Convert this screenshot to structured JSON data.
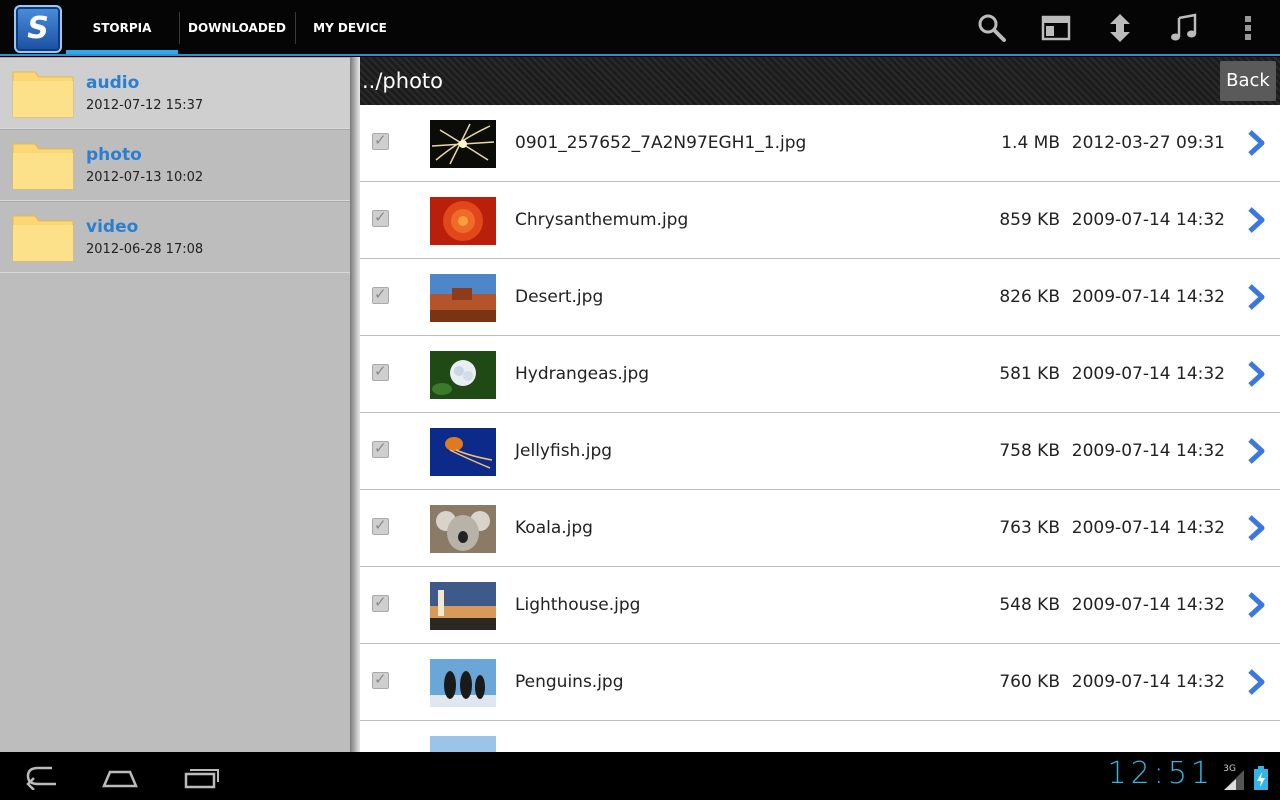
{
  "app": {
    "logo_letter": "S"
  },
  "tabs": [
    {
      "label": "STORPIA",
      "active": true
    },
    {
      "label": "DOWNLOADED",
      "active": false
    },
    {
      "label": "MY DEVICE",
      "active": false
    }
  ],
  "actionbar_icons": [
    "search-icon",
    "layout-icon",
    "sort-icon",
    "music-icon",
    "overflow-menu-icon"
  ],
  "sidebar": {
    "folders": [
      {
        "name": "audio",
        "date": "2012-07-12 15:37",
        "selected": true
      },
      {
        "name": "photo",
        "date": "2012-07-13 10:02",
        "selected": false
      },
      {
        "name": "video",
        "date": "2012-06-28 17:08",
        "selected": false
      }
    ]
  },
  "main": {
    "path": "../photo",
    "back_label": "Back",
    "files": [
      {
        "name": "0901_257652_7A2N97EGH1_1.jpg",
        "size": "1.4 MB",
        "date": "2012-03-27 09:31",
        "checked": true
      },
      {
        "name": "Chrysanthemum.jpg",
        "size": "859 KB",
        "date": "2009-07-14 14:32",
        "checked": true
      },
      {
        "name": "Desert.jpg",
        "size": "826 KB",
        "date": "2009-07-14 14:32",
        "checked": true
      },
      {
        "name": "Hydrangeas.jpg",
        "size": "581 KB",
        "date": "2009-07-14 14:32",
        "checked": true
      },
      {
        "name": "Jellyfish.jpg",
        "size": "758 KB",
        "date": "2009-07-14 14:32",
        "checked": true
      },
      {
        "name": "Koala.jpg",
        "size": "763 KB",
        "date": "2009-07-14 14:32",
        "checked": true
      },
      {
        "name": "Lighthouse.jpg",
        "size": "548 KB",
        "date": "2009-07-14 14:32",
        "checked": true
      },
      {
        "name": "Penguins.jpg",
        "size": "760 KB",
        "date": "2009-07-14 14:32",
        "checked": true
      }
    ]
  },
  "status": {
    "time": "12:51",
    "network": "3G"
  },
  "colors": {
    "accent": "#33b5e5",
    "folder_name": "#2a7fd0",
    "chevron": "#3a78e0"
  }
}
